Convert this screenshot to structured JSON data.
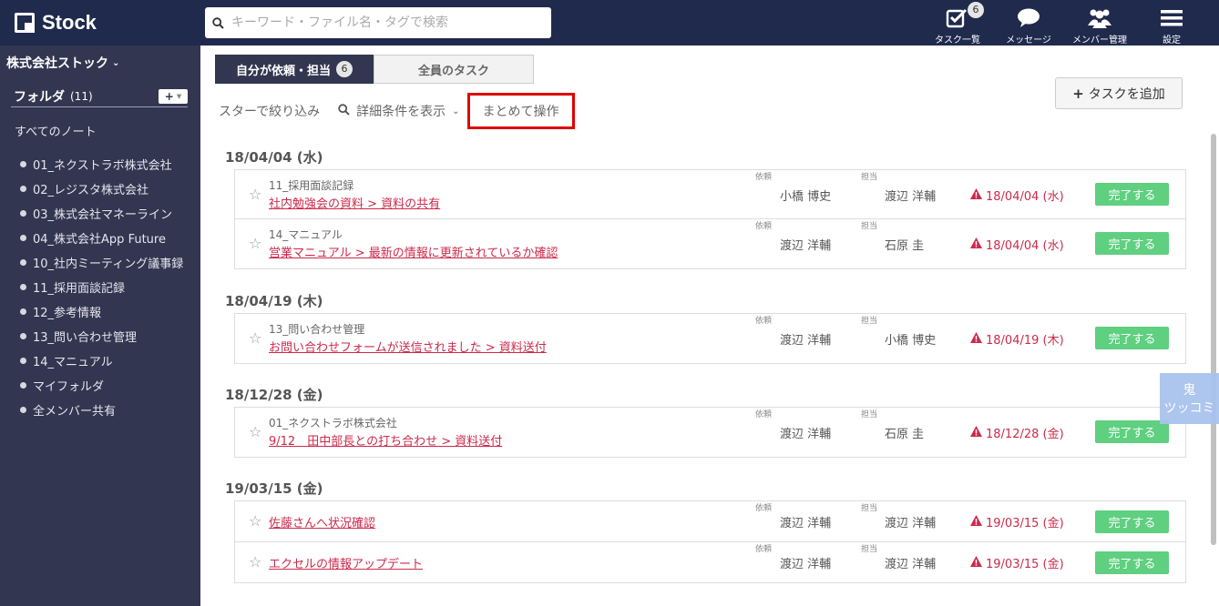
{
  "app": {
    "logo_text": "Stock"
  },
  "search": {
    "placeholder": "キーワード・ファイル名・タグで検索"
  },
  "topnav": {
    "tasks_label": "タスク一覧",
    "tasks_badge": "6",
    "messages_label": "メッセージ",
    "members_label": "メンバー管理",
    "settings_label": "設定"
  },
  "sidebar": {
    "company": "株式会社ストック",
    "folder_title": "フォルダ",
    "folder_count": "(11)",
    "all_notes": "すべてのノート",
    "folders": [
      "01_ネクストラボ株式会社",
      "02_レジスタ株式会社",
      "03_株式会社マネーライン",
      "04_株式会社App Future",
      "10_社内ミーティング議事録",
      "11_採用面談記録",
      "12_参考情報",
      "13_問い合わせ管理",
      "14_マニュアル",
      "マイフォルダ",
      "全メンバー共有"
    ]
  },
  "tabs": {
    "mine_label": "自分が依頼・担当",
    "mine_count": "6",
    "all_label": "全員のタスク"
  },
  "filters": {
    "star": "スターで絞り込み",
    "detail": "詳細条件を表示",
    "bulk": "まとめて操作"
  },
  "add_task": "タスクを追加",
  "labels": {
    "requester": "依頼",
    "assignee": "担当",
    "done": "完了する"
  },
  "groups": [
    {
      "date": "18/04/04 (水)",
      "tasks": [
        {
          "folder": "11_採用面談記録",
          "title": "社内勉強会の資料 > 資料の共有",
          "requester": "小橋 博史",
          "assignee": "渡辺 洋輔",
          "due": "18/04/04 (水)"
        },
        {
          "folder": "14_マニュアル",
          "title": "営業マニュアル > 最新の情報に更新されているか確認",
          "requester": "渡辺 洋輔",
          "assignee": "石原 圭",
          "due": "18/04/04 (水)"
        }
      ]
    },
    {
      "date": "18/04/19 (木)",
      "tasks": [
        {
          "folder": "13_問い合わせ管理",
          "title": "お問い合わせフォームが送信されました > 資料送付",
          "requester": "渡辺 洋輔",
          "assignee": "小橋 博史",
          "due": "18/04/19 (木)"
        }
      ]
    },
    {
      "date": "18/12/28 (金)",
      "tasks": [
        {
          "folder": "01_ネクストラボ株式会社",
          "title": "9/12　田中部長との打ち合わせ > 資料送付",
          "requester": "渡辺 洋輔",
          "assignee": "石原 圭",
          "due": "18/12/28 (金)"
        }
      ]
    },
    {
      "date": "19/03/15 (金)",
      "tasks": [
        {
          "folder": "",
          "title": "佐藤さんへ状況確認",
          "requester": "渡辺 洋輔",
          "assignee": "渡辺 洋輔",
          "due": "19/03/15 (金)"
        },
        {
          "folder": "",
          "title": "エクセルの情報アップデート",
          "requester": "渡辺 洋輔",
          "assignee": "渡辺 洋輔",
          "due": "19/03/15 (金)"
        }
      ]
    }
  ],
  "oni": {
    "line1": "鬼",
    "line2": "ツッコミ"
  }
}
